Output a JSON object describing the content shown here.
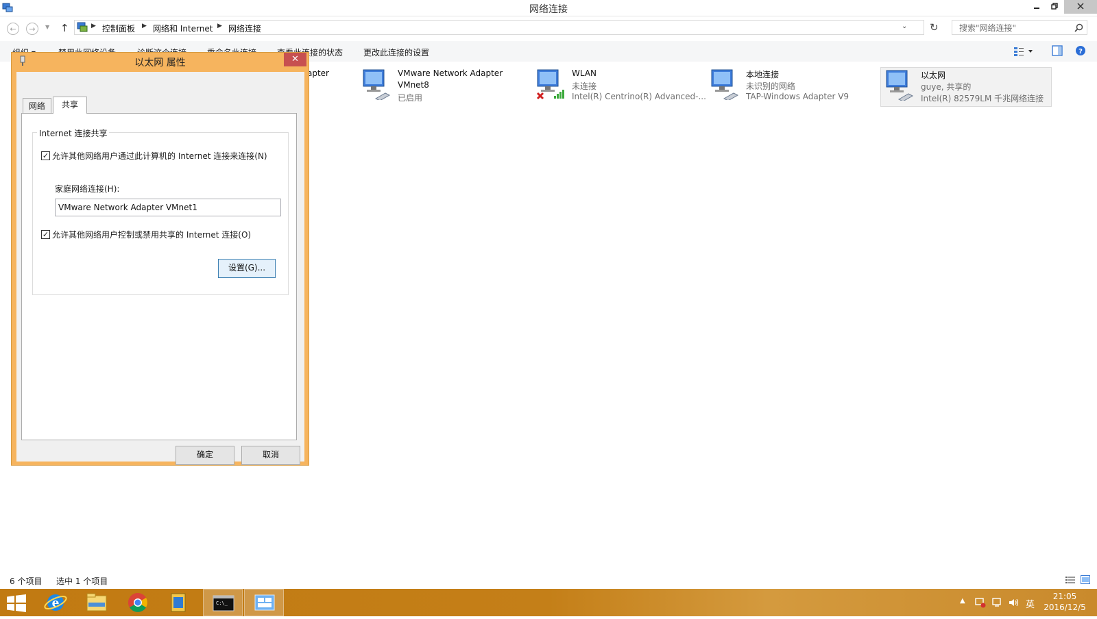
{
  "window": {
    "title": "网络连接"
  },
  "address": {
    "crumbs": [
      "控制面板",
      "网络和 Internet",
      "网络连接"
    ],
    "search_placeholder": "搜索\"网络连接\""
  },
  "commands": [
    "组织 ▾",
    "禁用此网络设备",
    "诊断这个连接",
    "重命名此连接",
    "查看此连接的状态",
    "更改此连接的设置"
  ],
  "adapters": [
    {
      "name": "VMware Network Adapter",
      "line2": "VMnet8",
      "line3": "已启用"
    },
    {
      "name": "WLAN",
      "line2": "未连接",
      "line3": "Intel(R) Centrino(R) Advanced-..."
    },
    {
      "name": "本地连接",
      "line2": "未识别的网络",
      "line3": "TAP-Windows Adapter V9"
    },
    {
      "name": "以太网",
      "line2": "guye, 共享的",
      "line3": "Intel(R) 82579LM 千兆网络连接"
    }
  ],
  "partial_adapter_text": "apter",
  "dialog": {
    "title": "以太网 属性",
    "tabs": [
      "网络",
      "共享"
    ],
    "group_title": "Internet 连接共享",
    "allow_share_label": "允许其他网络用户通过此计算机的 Internet 连接来连接(N)",
    "allow_share_checked": true,
    "home_label": "家庭网络连接(H):",
    "home_value": "VMware Network Adapter VMnet1",
    "allow_control_label": "允许其他网络用户控制或禁用共享的 Internet 连接(O)",
    "allow_control_checked": true,
    "settings_button": "设置(G)...",
    "ok_button": "确定",
    "cancel_button": "取消"
  },
  "status": {
    "item_count": "6 个项目",
    "selected": "选中 1 个项目"
  },
  "taskbar": {
    "ime": "英",
    "time": "21:05",
    "date": "2016/12/5"
  }
}
